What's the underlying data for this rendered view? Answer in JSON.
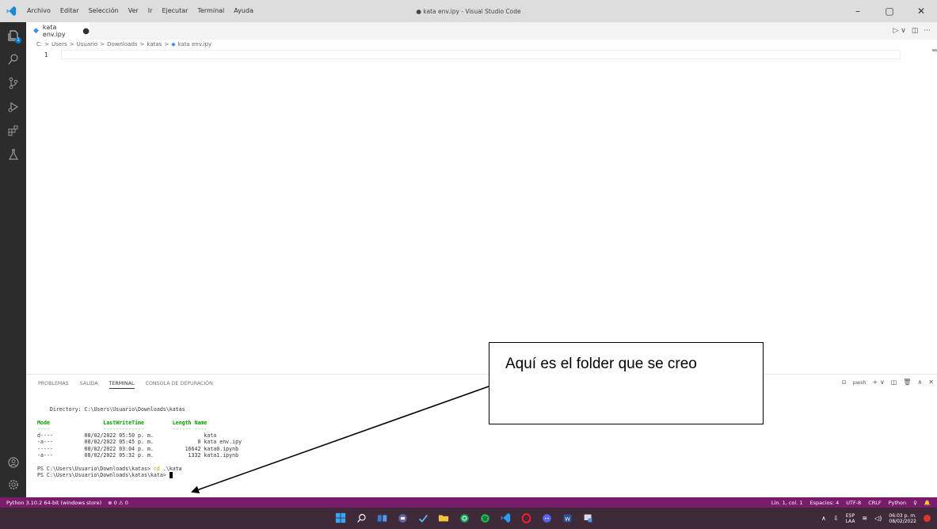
{
  "app": {
    "window_title": "● kata env.ipy - Visual Studio Code",
    "menu": [
      "Archivo",
      "Editar",
      "Selección",
      "Ver",
      "Ir",
      "Ejecutar",
      "Terminal",
      "Ayuda"
    ],
    "window_controls": {
      "minimize": "–",
      "maximize": "▢",
      "close": "✕"
    }
  },
  "activity_bar": {
    "explorer_badge": "1",
    "items": [
      "explorer-icon",
      "search-icon",
      "source-control-icon",
      "run-debug-icon",
      "extensions-icon",
      "testing-icon",
      "account-icon",
      "manage-gear-icon"
    ]
  },
  "editor": {
    "tab_label": "kata env.ipy",
    "tab_dirty": "●",
    "breadcrumb": [
      "C:",
      ">",
      "Users",
      ">",
      "Usuario",
      ">",
      "Downloads",
      ">",
      "katas",
      ">",
      "kata env.ipy"
    ],
    "line_number": "1",
    "actions": [
      "▷ ∨",
      "◫",
      "···"
    ]
  },
  "panel": {
    "tabs": [
      "PROBLEMAS",
      "SALIDA",
      "TERMINAL",
      "CONSOLA DE DEPURACIÓN"
    ],
    "active_tab": "TERMINAL",
    "shell": "pwsh",
    "actions": [
      "+ ∨",
      "◫",
      "🗑",
      "∧",
      "✕"
    ],
    "terminal": {
      "directory_line": "    Directory: C:\\Users\\Usuario\\Downloads\\katas",
      "header": "Mode                 LastWriteTime         Length Name",
      "header_rule": "----                 -------------         ------ ----",
      "rows": [
        "d----          08/02/2022 05:50 p. m.                kata",
        "-a---          08/02/2022 05:45 p. m.              0 kata env.ipy",
        "-----          08/02/2022 03:04 p. m.          16642 kata0.ipynb",
        "-a---          08/02/2022 05:32 p. m.           1332 kata1.ipynb"
      ],
      "prompt1": "PS C:\\Users\\Usuario\\Downloads\\katas> ",
      "prompt1_cmd": "cd",
      "prompt1_arg": " .\\kata",
      "prompt2": "PS C:\\Users\\Usuario\\Downloads\\katas\\kata> "
    }
  },
  "status_bar": {
    "left": [
      "Python 3.10.2 64-bit (windows store)",
      "⊗ 0 ⚠ 0"
    ],
    "right": [
      "Lín. 1, col. 1",
      "Espacios: 4",
      "UTF-8",
      "CRLF",
      "Python",
      "♀",
      "🔔"
    ]
  },
  "taskbar": {
    "lang_top": "ESP",
    "lang_bottom": "LAA",
    "time": "06:03 p. m.",
    "date": "08/02/2022"
  },
  "annotation": {
    "text": "Aquí es el folder que se creo"
  }
}
